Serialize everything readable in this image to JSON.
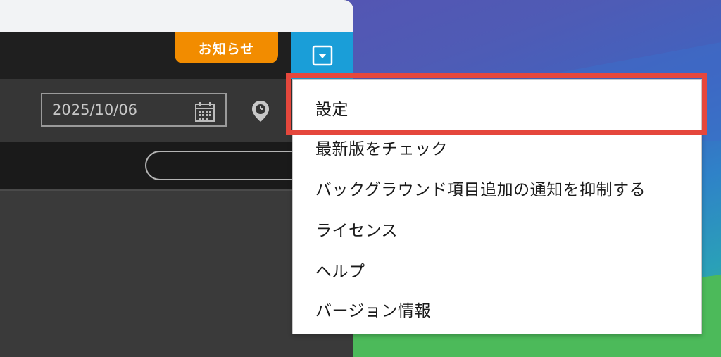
{
  "header": {
    "notice_label": "お知らせ"
  },
  "toolbar": {
    "date_value": "2025/10/06"
  },
  "menu": {
    "items": [
      {
        "label": "設定"
      },
      {
        "label": "最新版をチェック"
      },
      {
        "label": "バックグラウンド項目追加の通知を抑制する"
      },
      {
        "label": "ライセンス"
      },
      {
        "label": "ヘルプ"
      },
      {
        "label": "バージョン情報"
      }
    ]
  },
  "colors": {
    "notice": "#f28c00",
    "menu_toggle": "#1a9ed8",
    "highlight": "#e5473c"
  },
  "icons": {
    "menu_toggle": "chevron-down-icon",
    "calendar": "calendar-icon",
    "location": "location-pin-icon"
  }
}
